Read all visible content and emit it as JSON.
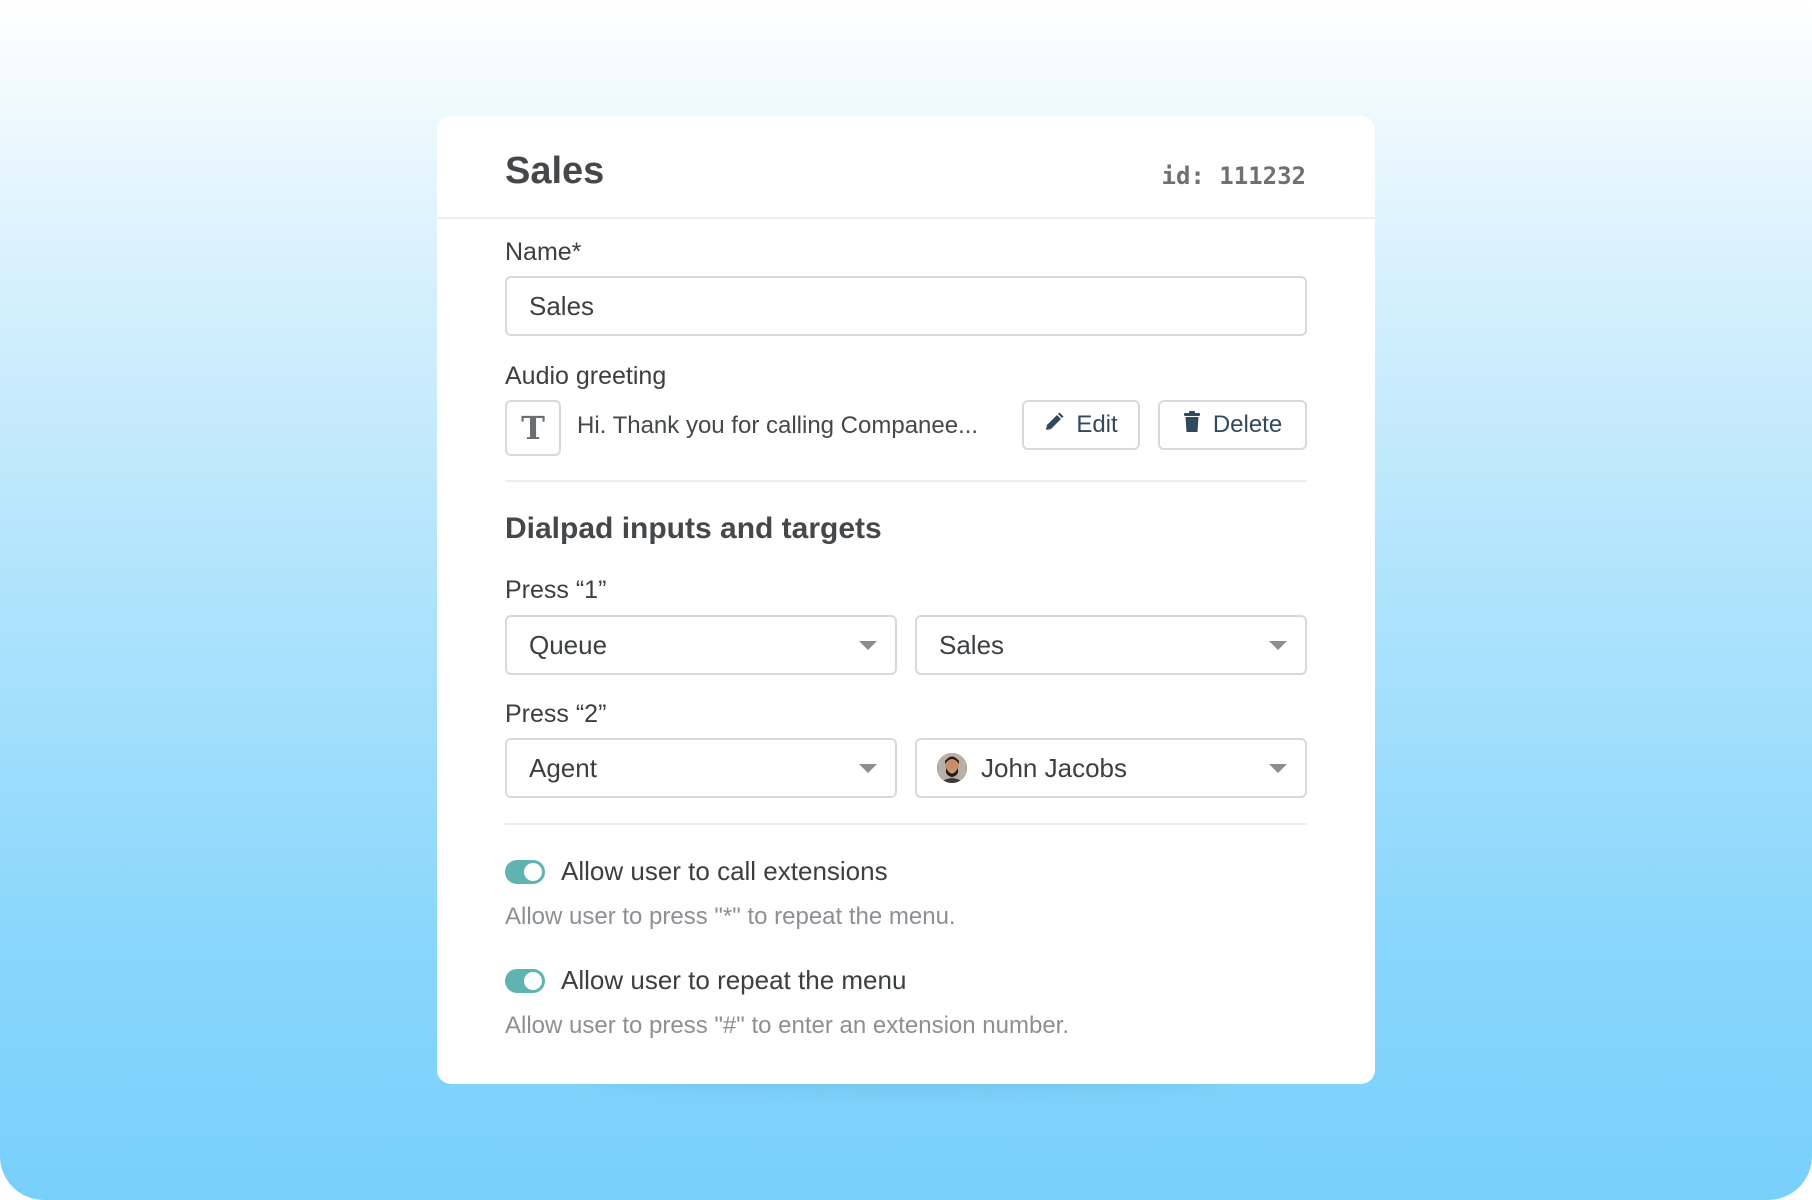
{
  "card": {
    "title": "Sales",
    "id_text": "id: 111232"
  },
  "name_field": {
    "label": "Name*",
    "value": "Sales"
  },
  "audio_greeting": {
    "label": "Audio greeting",
    "type_icon_glyph": "T",
    "text": "Hi. Thank you for calling Companee...",
    "edit_label": "Edit",
    "delete_label": "Delete"
  },
  "dialpad": {
    "section_title": "Dialpad inputs and targets",
    "inputs": [
      {
        "label": "Press “1”",
        "type": "Queue",
        "target": "Sales"
      },
      {
        "label": "Press “2”",
        "type": "Agent",
        "target": "John Jacobs"
      }
    ]
  },
  "options": [
    {
      "label": "Allow user to call extensions",
      "enabled": true,
      "helper": "Allow user to press \"*\" to repeat the menu."
    },
    {
      "label": "Allow user to repeat the menu",
      "enabled": true,
      "helper": "Allow user to press \"#\" to enter an extension number."
    }
  ],
  "colors": {
    "toggle_on": "#5fb3b0",
    "background_top": "#ffffff",
    "background_bottom": "#77d0fb",
    "button_text": "#2f4a5e"
  },
  "icons": {
    "text_type": "text-type-icon",
    "edit": "pencil-icon",
    "delete": "trash-icon",
    "dropdown": "caret-down-icon",
    "agent_avatar": "avatar"
  }
}
